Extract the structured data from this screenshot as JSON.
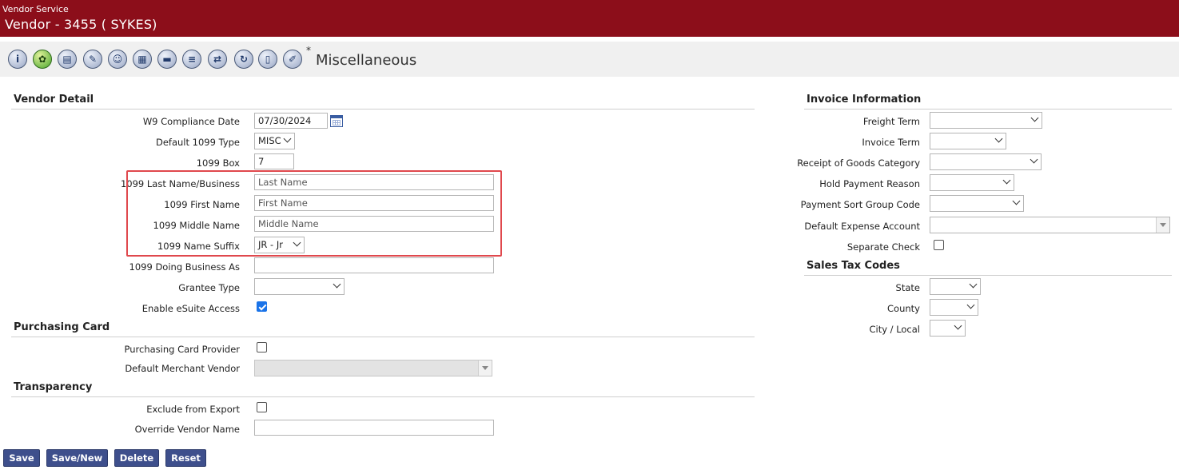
{
  "app": {
    "name": "Vendor Service",
    "window_title": "Vendor - 3455 ( SYKES)"
  },
  "toolbar": {
    "icons": [
      "info-icon",
      "vendor-tree-icon",
      "address-card-icon",
      "contacts-icon",
      "user-icon",
      "documents-icon",
      "payment-icon",
      "bank-icon",
      "transfer-icon",
      "history-icon",
      "notes-icon",
      "edit-icon"
    ],
    "modified_marker": "*",
    "title": "Miscellaneous"
  },
  "vendor_detail": {
    "title": "Vendor Detail",
    "w9_label": "W9 Compliance Date",
    "w9_value": "07/30/2024",
    "default_1099_type_label": "Default 1099 Type",
    "default_1099_type_value": "MISC",
    "box_1099_label": "1099 Box",
    "box_1099_value": "7",
    "last_name_label": "1099 Last Name/Business",
    "last_name_placeholder": "Last Name",
    "first_name_label": "1099 First Name",
    "first_name_placeholder": "First Name",
    "middle_name_label": "1099 Middle Name",
    "middle_name_placeholder": "Middle Name",
    "suffix_label": "1099 Name Suffix",
    "suffix_value": "JR - Jr",
    "dba_label": "1099 Doing Business As",
    "dba_value": "",
    "grantee_type_label": "Grantee Type",
    "grantee_type_value": "",
    "esuite_label": "Enable eSuite Access",
    "esuite_checked": true
  },
  "purchasing_card": {
    "title": "Purchasing Card",
    "provider_label": "Purchasing Card Provider",
    "provider_checked": false,
    "merchant_label": "Default Merchant Vendor",
    "merchant_value": ""
  },
  "transparency": {
    "title": "Transparency",
    "exclude_label": "Exclude from Export",
    "exclude_checked": false,
    "override_label": "Override Vendor Name",
    "override_value": ""
  },
  "invoice_information": {
    "title": "Invoice Information",
    "freight_term_label": "Freight Term",
    "invoice_term_label": "Invoice Term",
    "receipt_category_label": "Receipt of Goods Category",
    "hold_reason_label": "Hold Payment Reason",
    "sort_group_label": "Payment Sort Group Code",
    "expense_account_label": "Default Expense Account",
    "separate_check_label": "Separate Check",
    "separate_check_checked": false
  },
  "sales_tax": {
    "title": "Sales Tax Codes",
    "state_label": "State",
    "county_label": "County",
    "city_label": "City / Local"
  },
  "buttons": {
    "save": "Save",
    "save_new": "Save/New",
    "delete": "Delete",
    "reset": "Reset"
  },
  "colors": {
    "header": "#8c0e1a",
    "button": "#3e4f8c",
    "highlight": "#e0484d",
    "checkbox": "#1a73e8"
  }
}
